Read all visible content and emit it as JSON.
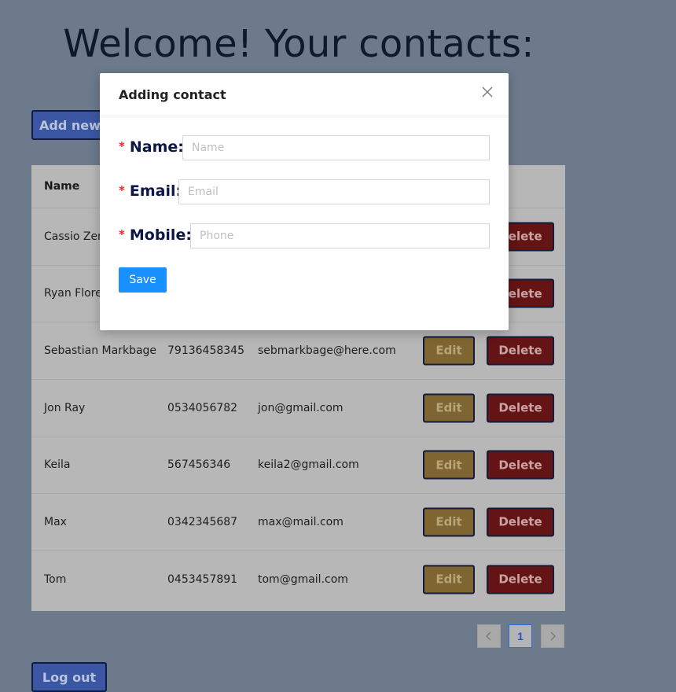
{
  "page": {
    "title": "Welcome! Your contacts:",
    "add_new_label": "Add new",
    "logout_label": "Log out"
  },
  "table": {
    "headers": {
      "name": "Name"
    },
    "rows": [
      {
        "name": "Cassio Zen",
        "phone": "",
        "email": ""
      },
      {
        "name": "Ryan Florence",
        "phone": "",
        "email": ""
      },
      {
        "name": "Sebastian Markbage",
        "phone": "79136458345",
        "email": "sebmarkbage@here.com"
      },
      {
        "name": "Jon Ray",
        "phone": "0534056782",
        "email": "jon@gmail.com"
      },
      {
        "name": "Keila",
        "phone": "567456346",
        "email": "keila2@gmail.com"
      },
      {
        "name": "Max",
        "phone": "0342345687",
        "email": "max@mail.com"
      },
      {
        "name": "Tom",
        "phone": "0453457891",
        "email": "tom@gmail.com"
      }
    ],
    "edit_label": "Edit",
    "delete_label": "Delete"
  },
  "pagination": {
    "prev_icon": "chevron-left-icon",
    "current_page": "1",
    "next_icon": "chevron-right-icon"
  },
  "modal": {
    "title": "Adding contact",
    "close_icon": "close-icon",
    "fields": {
      "name": {
        "label": "Name:",
        "placeholder": "Name",
        "value": ""
      },
      "email": {
        "label": "Email:",
        "placeholder": "Email",
        "value": ""
      },
      "mobile": {
        "label": "Mobile:",
        "placeholder": "Phone",
        "value": ""
      }
    },
    "required_mark": "*",
    "save_label": "Save"
  },
  "colors": {
    "background": "#6c7a8c",
    "primary": "#1890ff",
    "required": "#e0282e",
    "edit": "#7f6531",
    "delete": "#641414"
  }
}
